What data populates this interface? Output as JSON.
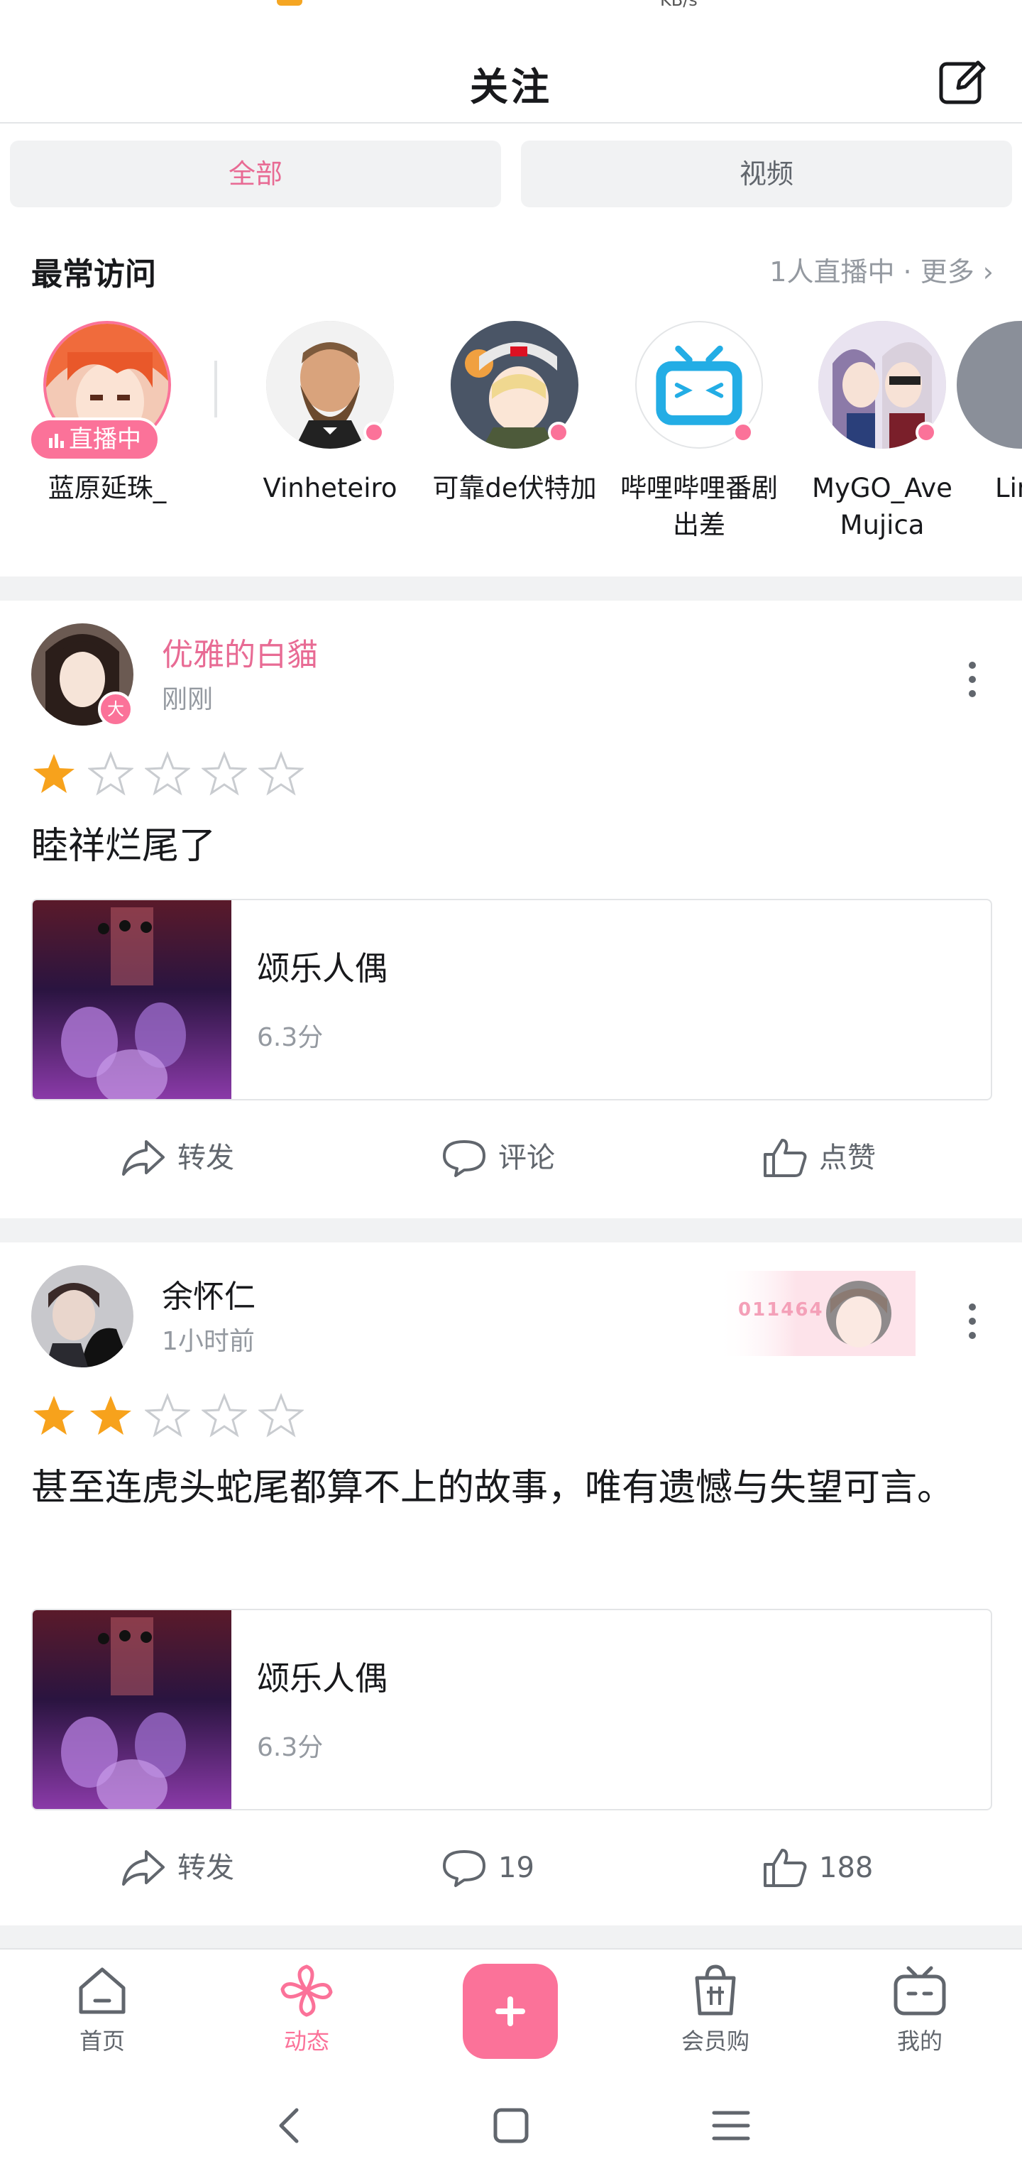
{
  "status": {
    "partial_text": "KB/s"
  },
  "header": {
    "title": "关注"
  },
  "tabs": [
    {
      "label": "全部",
      "active": true
    },
    {
      "label": "视频",
      "active": false
    }
  ],
  "frequent": {
    "title": "最常访问",
    "more": "1人直播中 · 更多 ›",
    "users": [
      {
        "name": "蓝原延珠_",
        "live_badge": "直播中"
      },
      {
        "name": "Vinheteiro"
      },
      {
        "name": "可靠de伏特加"
      },
      {
        "name": "哔哩哔哩番剧出差"
      },
      {
        "name": "MyGO_Ave Mujica"
      },
      {
        "name": "Lin"
      }
    ]
  },
  "posts": [
    {
      "author": "优雅的白貓",
      "badge": "大",
      "time": "刚刚",
      "rating": 1,
      "text": "睦祥烂尾了",
      "card": {
        "title": "颂乐人偶",
        "score": "6.3分"
      },
      "actions": {
        "repost": "转发",
        "comment": "评论",
        "like": "点赞"
      }
    },
    {
      "author": "余怀仁",
      "time": "1小时前",
      "decor_number": "011464",
      "rating": 2,
      "text": "甚至连虎头蛇尾都算不上的故事，唯有遗憾与失望可言。",
      "card": {
        "title": "颂乐人偶",
        "score": "6.3分"
      },
      "actions": {
        "repost": "转发",
        "comment": "19",
        "like": "188"
      }
    }
  ],
  "bottom_nav": [
    {
      "label": "首页",
      "icon": "home-icon"
    },
    {
      "label": "动态",
      "icon": "pinwheel-icon",
      "active": true
    },
    {
      "label": "会员购",
      "icon": "shopping-bag-icon"
    },
    {
      "label": "我的",
      "icon": "tv-icon"
    }
  ],
  "colors": {
    "accent": "#fb7299",
    "accent_text": "#e86b94",
    "star": "#f7a21c"
  }
}
